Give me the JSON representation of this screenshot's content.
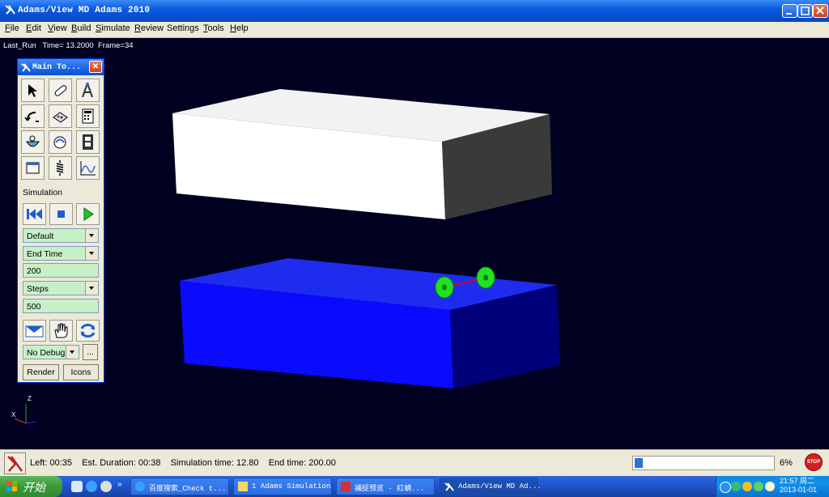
{
  "window": {
    "title": "Adams/View MD Adams 2010"
  },
  "menu": [
    {
      "key": "F",
      "rest": "ile"
    },
    {
      "key": "E",
      "rest": "dit"
    },
    {
      "key": "V",
      "rest": "iew"
    },
    {
      "key": "B",
      "rest": "uild"
    },
    {
      "key": "S",
      "rest": "imulate"
    },
    {
      "key": "R",
      "rest": "eview"
    },
    {
      "key": "",
      "rest": "Settings"
    },
    {
      "key": "T",
      "rest": "ools"
    },
    {
      "key": "H",
      "rest": "elp"
    }
  ],
  "viewport": {
    "run_info": "Last_Run   Time= 13.2000  Frame=34",
    "axis_labels": {
      "z": "Z",
      "x": "X"
    }
  },
  "toolbox": {
    "title": "Main To...",
    "tools": [
      "select-arrow-icon",
      "link-icon",
      "compass-icon",
      "arc-curve-icon",
      "assembly-icon",
      "calculator-icon",
      "bowl-icon",
      "measure-icon",
      "filmstrip-icon",
      "window-icon",
      "spring-icon",
      "plot-icon"
    ],
    "simulation_label": "Simulation",
    "sim_type": "Default",
    "end_mode": "End Time",
    "end_value": "200",
    "step_mode": "Steps",
    "step_value": "500",
    "debug": "No Debug",
    "more": "...",
    "render_label": "Render",
    "icons_label": "Icons"
  },
  "status": {
    "text": "Left: 00:35    Est. Duration: 00:38    Simulation time: 12.80    End time: 200.00",
    "progress_fraction": 0.06,
    "percent": "6%",
    "stop_label": "STOP"
  },
  "taskbar": {
    "start": "开始",
    "tasks": [
      {
        "label": "百度搜索_Check t...",
        "active": false
      },
      {
        "label": "1 Adams Simulation",
        "active": false
      },
      {
        "label": "捕捉预览 - 红蜻...",
        "active": false
      },
      {
        "label": "Adams/View MD Ad...",
        "active": true
      }
    ],
    "time": "21:57 周二",
    "date": "2013-01-01"
  },
  "colors": {
    "viewport_bg": "#000020",
    "upper_block": "#f2f2f2",
    "lower_block": "#1010ff",
    "wheels": "#22e022"
  }
}
